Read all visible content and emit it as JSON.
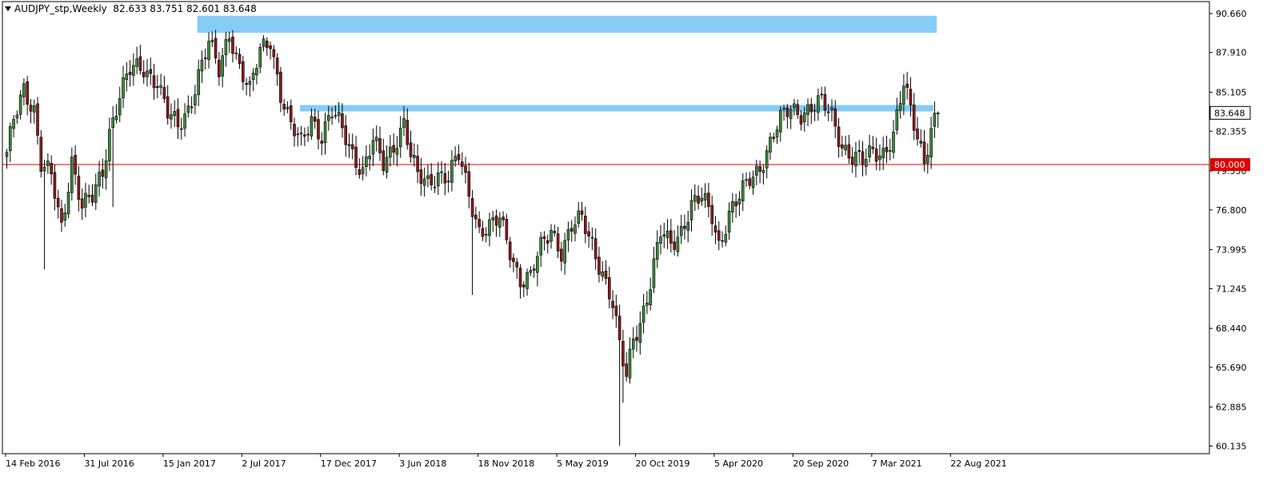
{
  "header": {
    "symbol": "AUDJPY_stp,Weekly",
    "ohlc": "82.633 83.751 82.601 83.648"
  },
  "colors": {
    "bull": "#3c8a3c",
    "bear": "#8c1c1c",
    "wick": "#000000",
    "zone": "#87ccf7",
    "hline": "#e00000",
    "frame": "#000000",
    "price_tag_bg": "#ffffff",
    "hline_tag_bg": "#e00000"
  },
  "chart_data": {
    "type": "candlestick",
    "y_ticks": [
      "90.660",
      "87.910",
      "85.105",
      "82.355",
      "79.550",
      "76.800",
      "73.995",
      "71.245",
      "68.440",
      "65.690",
      "62.885",
      "60.135"
    ],
    "x_labels": [
      "14 Feb 2016",
      "31 Jul 2016",
      "15 Jan 2017",
      "2 Jul 2017",
      "17 Dec 2017",
      "3 Jun 2018",
      "18 Nov 2018",
      "5 May 2019",
      "20 Oct 2019",
      "5 Apr 2020",
      "20 Sep 2020",
      "7 Mar 2021",
      "22 Aug 2021"
    ],
    "ylim": [
      59.6,
      91.5
    ],
    "current_price": "83.648",
    "horizontal_line": {
      "value": 80.0,
      "label": "80.000"
    },
    "zones": [
      {
        "from_week": 56,
        "to_week": 272,
        "top": 90.5,
        "bottom": 89.3
      },
      {
        "from_week": 86,
        "to_week": 271,
        "top": 84.2,
        "bottom": 83.75
      }
    ],
    "waypoints": [
      [
        0,
        80.5
      ],
      [
        2,
        83.0
      ],
      [
        5,
        85.5
      ],
      [
        8,
        84.0
      ],
      [
        10,
        80.0
      ],
      [
        13,
        79.0
      ],
      [
        16,
        75.5
      ],
      [
        19,
        80.5
      ],
      [
        22,
        77.0
      ],
      [
        25,
        77.5
      ],
      [
        28,
        79.5
      ],
      [
        30,
        82.5
      ],
      [
        33,
        85.0
      ],
      [
        36,
        86.5
      ],
      [
        40,
        86.8
      ],
      [
        44,
        86.0
      ],
      [
        47,
        83.5
      ],
      [
        50,
        82.5
      ],
      [
        53,
        84.0
      ],
      [
        56,
        86.5
      ],
      [
        59,
        88.5
      ],
      [
        62,
        86.5
      ],
      [
        65,
        89.5
      ],
      [
        68,
        87.0
      ],
      [
        71,
        85.0
      ],
      [
        74,
        88.0
      ],
      [
        77,
        89.0
      ],
      [
        80,
        85.0
      ],
      [
        83,
        82.5
      ],
      [
        86,
        81.5
      ],
      [
        89,
        83.5
      ],
      [
        92,
        82.0
      ],
      [
        95,
        83.5
      ],
      [
        98,
        82.5
      ],
      [
        101,
        81.0
      ],
      [
        104,
        79.5
      ],
      [
        107,
        81.5
      ],
      [
        110,
        80.0
      ],
      [
        113,
        81.5
      ],
      [
        116,
        83.0
      ],
      [
        118,
        80.5
      ],
      [
        120,
        79.0
      ],
      [
        123,
        78.8
      ],
      [
        126,
        79.5
      ],
      [
        129,
        79.0
      ],
      [
        132,
        80.5
      ],
      [
        135,
        78.0
      ],
      [
        138,
        75.5
      ],
      [
        141,
        75.5
      ],
      [
        144,
        76.0
      ],
      [
        147,
        74.0
      ],
      [
        150,
        72.0
      ],
      [
        153,
        72.0
      ],
      [
        156,
        74.0
      ],
      [
        159,
        75.5
      ],
      [
        162,
        74.0
      ],
      [
        165,
        75.5
      ],
      [
        168,
        76.0
      ],
      [
        171,
        74.5
      ],
      [
        174,
        72.5
      ],
      [
        177,
        70.0
      ],
      [
        179,
        67.0
      ],
      [
        181,
        65.0
      ],
      [
        183,
        68.0
      ],
      [
        185,
        69.0
      ],
      [
        188,
        71.5
      ],
      [
        191,
        75.0
      ],
      [
        194,
        74.5
      ],
      [
        197,
        75.5
      ],
      [
        200,
        77.0
      ],
      [
        203,
        77.5
      ],
      [
        206,
        76.5
      ],
      [
        208,
        74.5
      ],
      [
        211,
        76.5
      ],
      [
        214,
        77.5
      ],
      [
        217,
        79.0
      ],
      [
        220,
        80.0
      ],
      [
        223,
        81.5
      ],
      [
        226,
        83.0
      ],
      [
        229,
        84.0
      ],
      [
        232,
        83.8
      ],
      [
        235,
        84.0
      ],
      [
        238,
        84.2
      ],
      [
        241,
        83.5
      ],
      [
        244,
        81.5
      ],
      [
        247,
        80.5
      ],
      [
        250,
        80.0
      ],
      [
        253,
        81.0
      ],
      [
        256,
        81.0
      ],
      [
        259,
        82.0
      ],
      [
        262,
        85.5
      ],
      [
        265,
        83.0
      ],
      [
        268,
        80.5
      ],
      [
        270,
        82.5
      ],
      [
        272,
        83.6
      ]
    ]
  }
}
